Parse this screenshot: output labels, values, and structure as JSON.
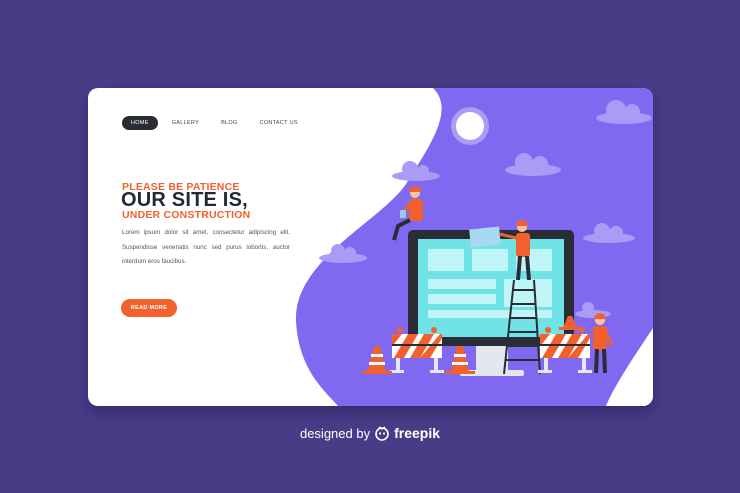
{
  "nav": {
    "items": [
      {
        "label": "HOME",
        "active": true
      },
      {
        "label": "GALLERY",
        "active": false
      },
      {
        "label": "BLOG",
        "active": false
      },
      {
        "label": "CONTACT US",
        "active": false
      }
    ]
  },
  "hero": {
    "line1": "PLEASE BE PATIENCE",
    "line2": "OUR SITE IS,",
    "line3": "UNDER CONSTRUCTION",
    "body": "Lorem ipsum dolor sit amet, consectetur adipiscing elit. Suspendisse venenatis nunc sed purus lobortis, auctor interdum eros faucibus.",
    "button_label": "READ MORE"
  },
  "footer": {
    "designed_by": "designed by",
    "brand": "freepik"
  },
  "colors": {
    "background": "#4a3b86",
    "panel": "#8068f1",
    "accent": "#f2612d",
    "dark": "#2a2d35",
    "screen": "#6fe3e6"
  },
  "icons": [
    "sun-icon",
    "cloud-icon",
    "barrier-icon",
    "traffic-cone-icon",
    "ladder-icon",
    "worker-icon",
    "freepik-logo-icon"
  ]
}
